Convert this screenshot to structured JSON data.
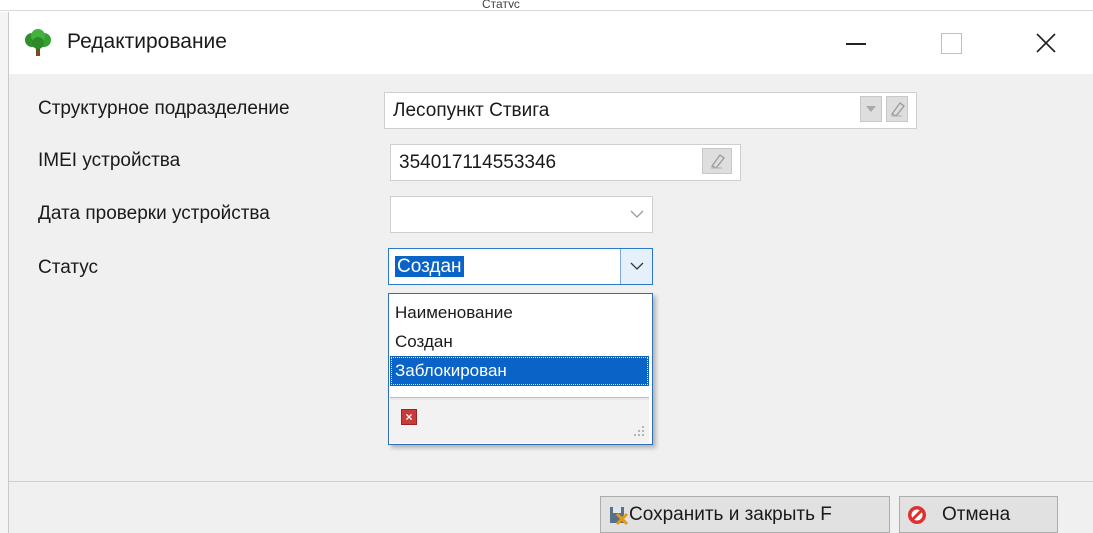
{
  "window": {
    "title": "Редактирование"
  },
  "background": {
    "fragment_text": "Статус"
  },
  "form": {
    "department": {
      "label": "Структурное подразделение",
      "value": "Лесопункт Ствига"
    },
    "imei": {
      "label": "IMEI устройства",
      "value": "354017114553346"
    },
    "check_date": {
      "label": "Дата проверки устройства",
      "value": ""
    },
    "status": {
      "label": "Статус",
      "value": "Создан"
    }
  },
  "status_dropdown": {
    "items": [
      {
        "label": "Наименование",
        "selected": false
      },
      {
        "label": "Создан",
        "selected": false
      },
      {
        "label": "Заблокирован",
        "selected": true
      }
    ]
  },
  "footer": {
    "save_label": "Сохранить и закрыть F",
    "cancel_label": "Отмена"
  },
  "colors": {
    "selection": "#0a64c8",
    "focus_border": "#2b78cf",
    "window_bg": "#f0f0f0"
  },
  "icons": [
    "tree-app-icon",
    "minimize-icon",
    "maximize-icon",
    "close-icon",
    "chevron-down-icon",
    "eraser-icon",
    "clear-x-icon",
    "resize-grip-icon",
    "save-close-icon",
    "cancel-icon"
  ]
}
